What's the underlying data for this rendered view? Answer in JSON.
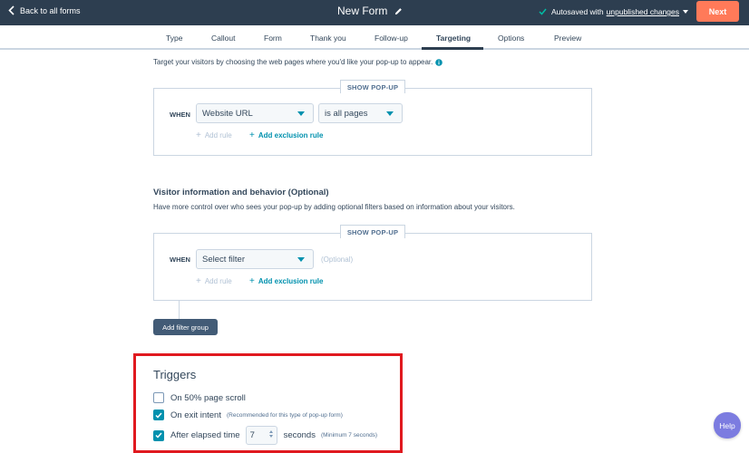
{
  "header": {
    "back_label": "Back to all forms",
    "title": "New Form",
    "autosave_text": "Autosaved with",
    "autosave_link": "unpublished changes",
    "next_label": "Next"
  },
  "tabs": [
    {
      "label": "Type"
    },
    {
      "label": "Callout"
    },
    {
      "label": "Form"
    },
    {
      "label": "Thank you"
    },
    {
      "label": "Follow-up"
    },
    {
      "label": "Targeting",
      "active": true
    },
    {
      "label": "Options"
    },
    {
      "label": "Preview"
    }
  ],
  "targeting": {
    "intro": "Target your visitors by choosing the web pages where you'd like your pop-up to appear.",
    "badge": "SHOW POP-UP",
    "when": "WHEN",
    "filter": "Website URL",
    "operator": "is all pages",
    "add_rule": "Add rule",
    "add_exclusion": "Add exclusion rule"
  },
  "visitor": {
    "title": "Visitor information and behavior (Optional)",
    "description": "Have more control over who sees your pop-up by adding optional filters based on information about your visitors.",
    "badge": "SHOW POP-UP",
    "when": "WHEN",
    "filter": "Select filter",
    "optional": "(Optional)",
    "add_rule": "Add rule",
    "add_exclusion": "Add exclusion rule",
    "add_group": "Add filter group"
  },
  "triggers": {
    "title": "Triggers",
    "items": [
      {
        "label": "On 50% page scroll",
        "checked": false
      },
      {
        "label": "On exit intent",
        "note": "(Recommended for this type of pop-up form)",
        "checked": true
      },
      {
        "label": "After elapsed time",
        "value": "7",
        "suffix": "seconds",
        "note": "(Minimum 7 seconds)",
        "checked": true
      }
    ]
  },
  "help_label": "Help",
  "colors": {
    "topbar": "#2d3e50",
    "accent": "#ff7a59",
    "link": "#0091ae",
    "highlight": "#e0191f"
  }
}
